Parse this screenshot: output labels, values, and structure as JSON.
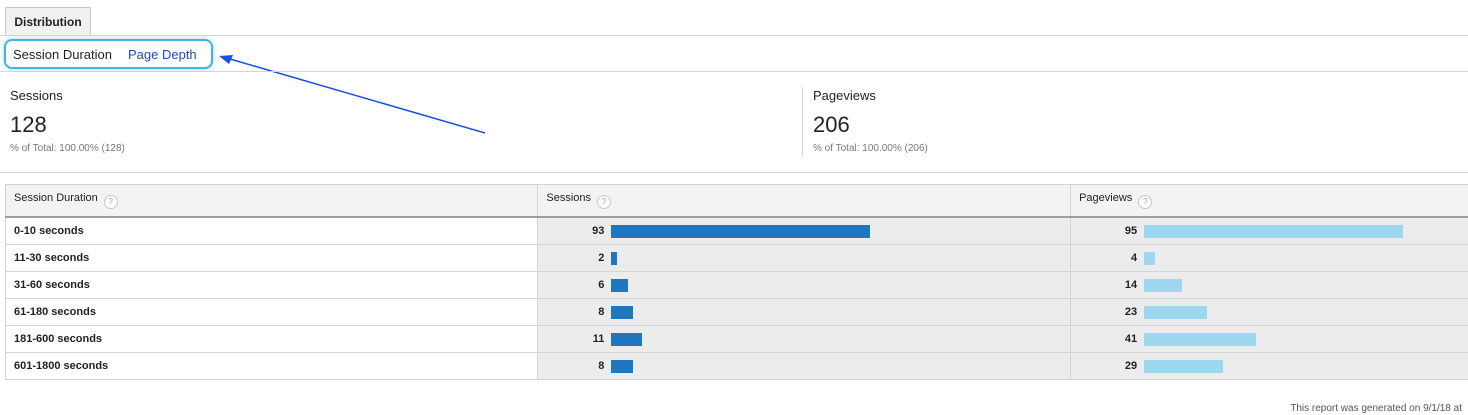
{
  "tabs": {
    "distribution": "Distribution"
  },
  "subtabs": {
    "active": "Session Duration",
    "link": "Page Depth"
  },
  "metrics": [
    {
      "label": "Sessions",
      "value": "128",
      "sub": "% of Total: 100.00% (128)"
    },
    {
      "label": "Pageviews",
      "value": "206",
      "sub": "% of Total: 100.00% (206)"
    }
  ],
  "table": {
    "headers": [
      "Session Duration",
      "Sessions",
      "Pageviews"
    ],
    "help_glyph": "?",
    "rows": [
      {
        "label": "0-10 seconds",
        "sessions": 93,
        "pageviews": 95
      },
      {
        "label": "11-30 seconds",
        "sessions": 2,
        "pageviews": 4
      },
      {
        "label": "31-60 seconds",
        "sessions": 6,
        "pageviews": 14
      },
      {
        "label": "61-180 seconds",
        "sessions": 8,
        "pageviews": 23
      },
      {
        "label": "181-600 seconds",
        "sessions": 11,
        "pageviews": 41
      },
      {
        "label": "601-1800 seconds",
        "sessions": 8,
        "pageviews": 29
      }
    ]
  },
  "footer": "This report was generated on 9/1/18 at",
  "colors": {
    "sessions_bar": "#1f78bf",
    "pageviews_bar": "#9ed8f0",
    "highlight": "#45b3df",
    "arrow": "#1a4fe0"
  }
}
